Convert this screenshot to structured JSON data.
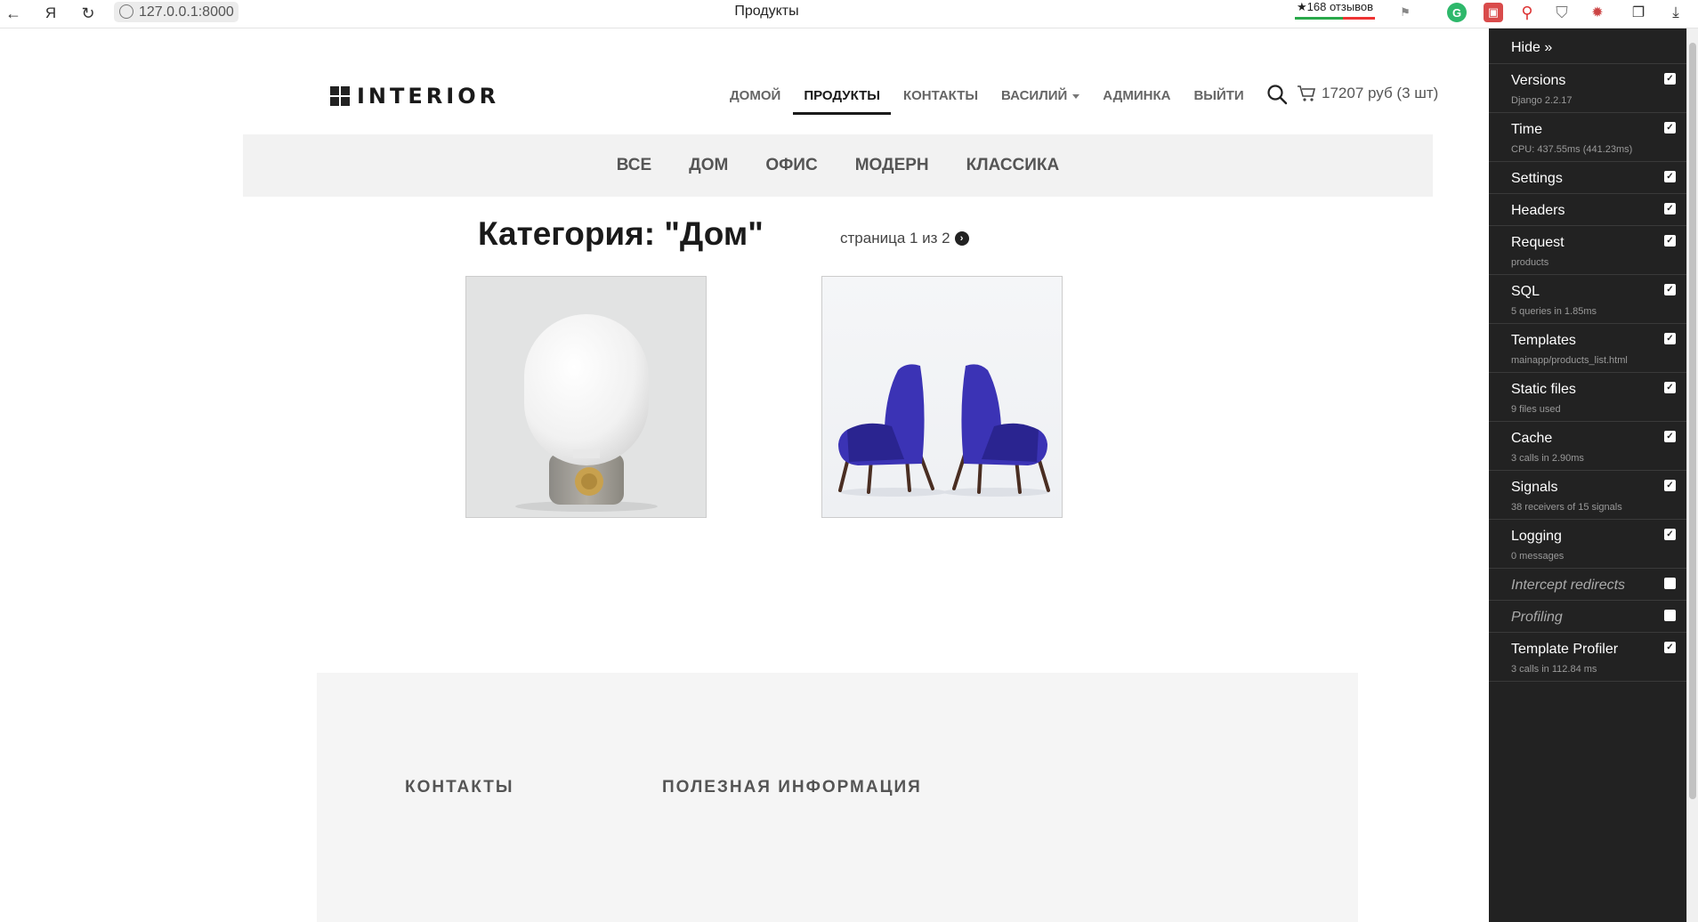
{
  "browser": {
    "address": "127.0.0.1:8000",
    "tab_title": "Продукты",
    "reviews": "★168 отзывов"
  },
  "site": {
    "logo": "INTERIOR",
    "nav": [
      {
        "label": "ДОМОЙ"
      },
      {
        "label": "ПРОДУКТЫ",
        "active": true
      },
      {
        "label": "КОНТАКТЫ"
      },
      {
        "label": "ВАСИЛИЙ",
        "dropdown": true
      },
      {
        "label": "АДМИНКА"
      },
      {
        "label": "ВЫЙТИ"
      }
    ],
    "basket": "17207 руб (3 шт)"
  },
  "categories": [
    "ВСЕ",
    "ДОМ",
    "ОФИС",
    "МОДЕРН",
    "КЛАССИКА"
  ],
  "page": {
    "title": "Категория: \"Дом\"",
    "pagination": "страница 1 из 2"
  },
  "products": [
    {
      "name": "lamp"
    },
    {
      "name": "chairs"
    }
  ],
  "footer": {
    "contacts": "КОНТАКТЫ",
    "info": "ПОЛЕЗНАЯ ИНФОРМАЦИЯ"
  },
  "debug_toolbar": {
    "hide": "Hide »",
    "panels": [
      {
        "title": "Versions",
        "subtitle": "Django 2.2.17",
        "checked": true
      },
      {
        "title": "Time",
        "subtitle": "CPU: 437.55ms (441.23ms)",
        "checked": true
      },
      {
        "title": "Settings",
        "subtitle": "",
        "checked": true
      },
      {
        "title": "Headers",
        "subtitle": "",
        "checked": true
      },
      {
        "title": "Request",
        "subtitle": "products",
        "checked": true
      },
      {
        "title": "SQL",
        "subtitle": "5 queries in 1.85ms",
        "checked": true
      },
      {
        "title": "Templates",
        "subtitle": "mainapp/products_list.html",
        "checked": true
      },
      {
        "title": "Static files",
        "subtitle": "9 files used",
        "checked": true
      },
      {
        "title": "Cache",
        "subtitle": "3 calls in 2.90ms",
        "checked": true
      },
      {
        "title": "Signals",
        "subtitle": "38 receivers of 15 signals",
        "checked": true
      },
      {
        "title": "Logging",
        "subtitle": "0 messages",
        "checked": true
      },
      {
        "title": "Intercept redirects",
        "subtitle": "",
        "checked": false
      },
      {
        "title": "Profiling",
        "subtitle": "",
        "checked": false
      },
      {
        "title": "Template Profiler",
        "subtitle": "3 calls in 112.84 ms",
        "checked": true
      }
    ]
  }
}
